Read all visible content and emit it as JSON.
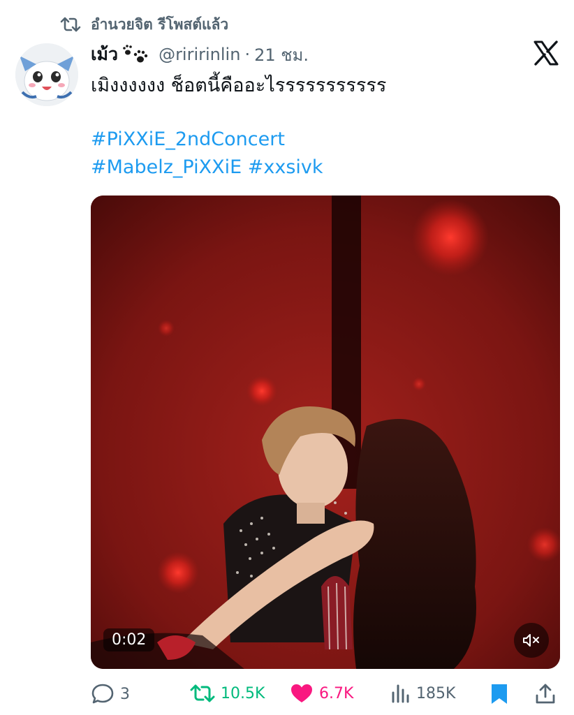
{
  "retweet": {
    "label": "อำนวยจิต รีโพสต์แล้ว",
    "icon": "retweet-icon"
  },
  "author": {
    "name": "เม้ว",
    "name_emoji_icon": "paw-prints-icon",
    "handle": "@riririnlin",
    "separator": "·",
    "time": "21 ชม."
  },
  "brand": {
    "icon": "x-logo-icon"
  },
  "tweet": {
    "text": "เมิงงงงงง ช็อตนี้คืออะไรรรรรรรรรรร",
    "hashtags": [
      "#PiXXiE_2ndConcert",
      "#Mabelz_PiXXiE",
      "#xxsivk"
    ]
  },
  "media": {
    "duration": "0:02",
    "mute_icon": "volume-muted-icon"
  },
  "actions": {
    "replies": "3",
    "reposts": "10.5K",
    "likes": "6.7K",
    "views": "185K"
  },
  "colors": {
    "link": "#1d9bf0",
    "repost_active": "#00ba7c",
    "like_active": "#f91880",
    "bookmark_active": "#1d9bf0",
    "muted": "#536471"
  }
}
